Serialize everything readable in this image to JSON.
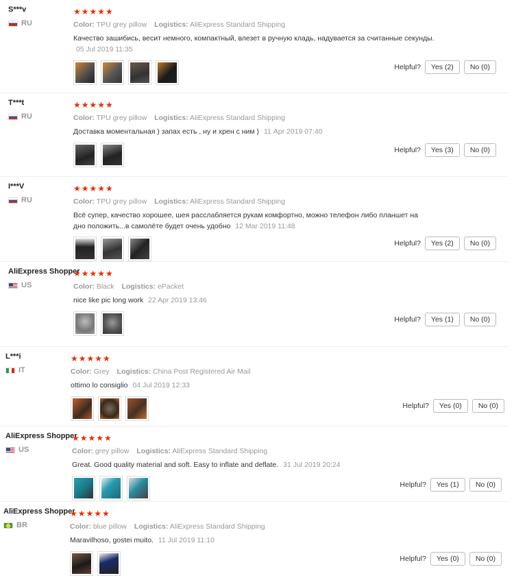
{
  "stars": "★★★★★",
  "helpful_label": "Helpful?",
  "labels": {
    "color": "Color:",
    "logistics": "Logistics:"
  },
  "reviews": [
    {
      "user": "S***v",
      "country": "RU",
      "color": "TPU grey pillow",
      "logistics": "AliExpress Standard Shipping",
      "text": "Качество зашибись, весит немного, компактный, влезет в ручную кладь, надувается за считанные секунды.",
      "date": "05 Jul 2019 11:35",
      "yes": "Yes (2)",
      "no": "No (0)"
    },
    {
      "user": "T***t",
      "country": "RU",
      "color": "TPU grey pillow",
      "logistics": "AliExpress Standard Shipping",
      "text": "Доставка моментальная ) запах есть , ну и хрен с ним )",
      "date": "11 Apr 2019 07:40",
      "yes": "Yes (3)",
      "no": "No (0)"
    },
    {
      "user": "I***V",
      "country": "RU",
      "color": "TPU grey pillow",
      "logistics": "AliExpress Standard Shipping",
      "text": "Всё супер, качество хорошее, шея расслабляется рукам комфортно, можно телефон либо планшет на дно положить...в самолёте будет очень удобно",
      "date": "12 Mar 2019 11:48",
      "yes": "Yes (2)",
      "no": "No (0)"
    },
    {
      "user": "AliExpress Shopper",
      "country": "US",
      "color": "Black",
      "logistics": "ePacket",
      "text": "nice like pic long work",
      "date": "22 Apr 2019 13:46",
      "yes": "Yes (1)",
      "no": "No (0)"
    },
    {
      "user": "L***i",
      "country": "IT",
      "color": "Grey",
      "logistics": "China Post Registered Air Mail",
      "text": "ottimo lo consiglio",
      "date": "04 Jul 2019 12:33",
      "yes": "Yes (0)",
      "no": "No (0)"
    },
    {
      "user": "AliExpress Shopper",
      "country": "US",
      "color": "grey pillow",
      "logistics": "AliExpress Standard Shipping",
      "text": "Great. Good quality material and soft. Easy to inflate and deflate.",
      "date": "31 Jul 2019 20:24",
      "yes": "Yes (1)",
      "no": "No (0)"
    },
    {
      "user": "AliExpress Shopper",
      "country": "BR",
      "color": "blue pillow",
      "logistics": "AliExpress Standard Shipping",
      "text": "Maravilhoso, gostei muito.",
      "date": "11 Jul 2019 11:10",
      "yes": "Yes (0)",
      "no": "No (0)"
    }
  ]
}
